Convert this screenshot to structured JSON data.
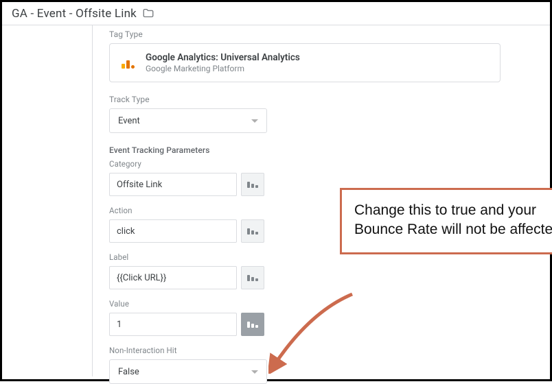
{
  "header": {
    "title": "GA - Event - Offsite Link"
  },
  "tagType": {
    "label": "Tag Type",
    "name": "Google Analytics: Universal Analytics",
    "platform": "Google Marketing Platform"
  },
  "trackType": {
    "label": "Track Type",
    "value": "Event"
  },
  "eventParams": {
    "section_label": "Event Tracking Parameters",
    "category": {
      "label": "Category",
      "value": "Offsite Link"
    },
    "action": {
      "label": "Action",
      "value": "click"
    },
    "label": {
      "label": "Label",
      "value": "{{Click URL}}"
    },
    "value": {
      "label": "Value",
      "value": "1"
    }
  },
  "nonInteraction": {
    "label": "Non-Interaction Hit",
    "value": "False"
  },
  "annotation": {
    "text": "Change this to true and your Bounce Rate will not be affected"
  }
}
